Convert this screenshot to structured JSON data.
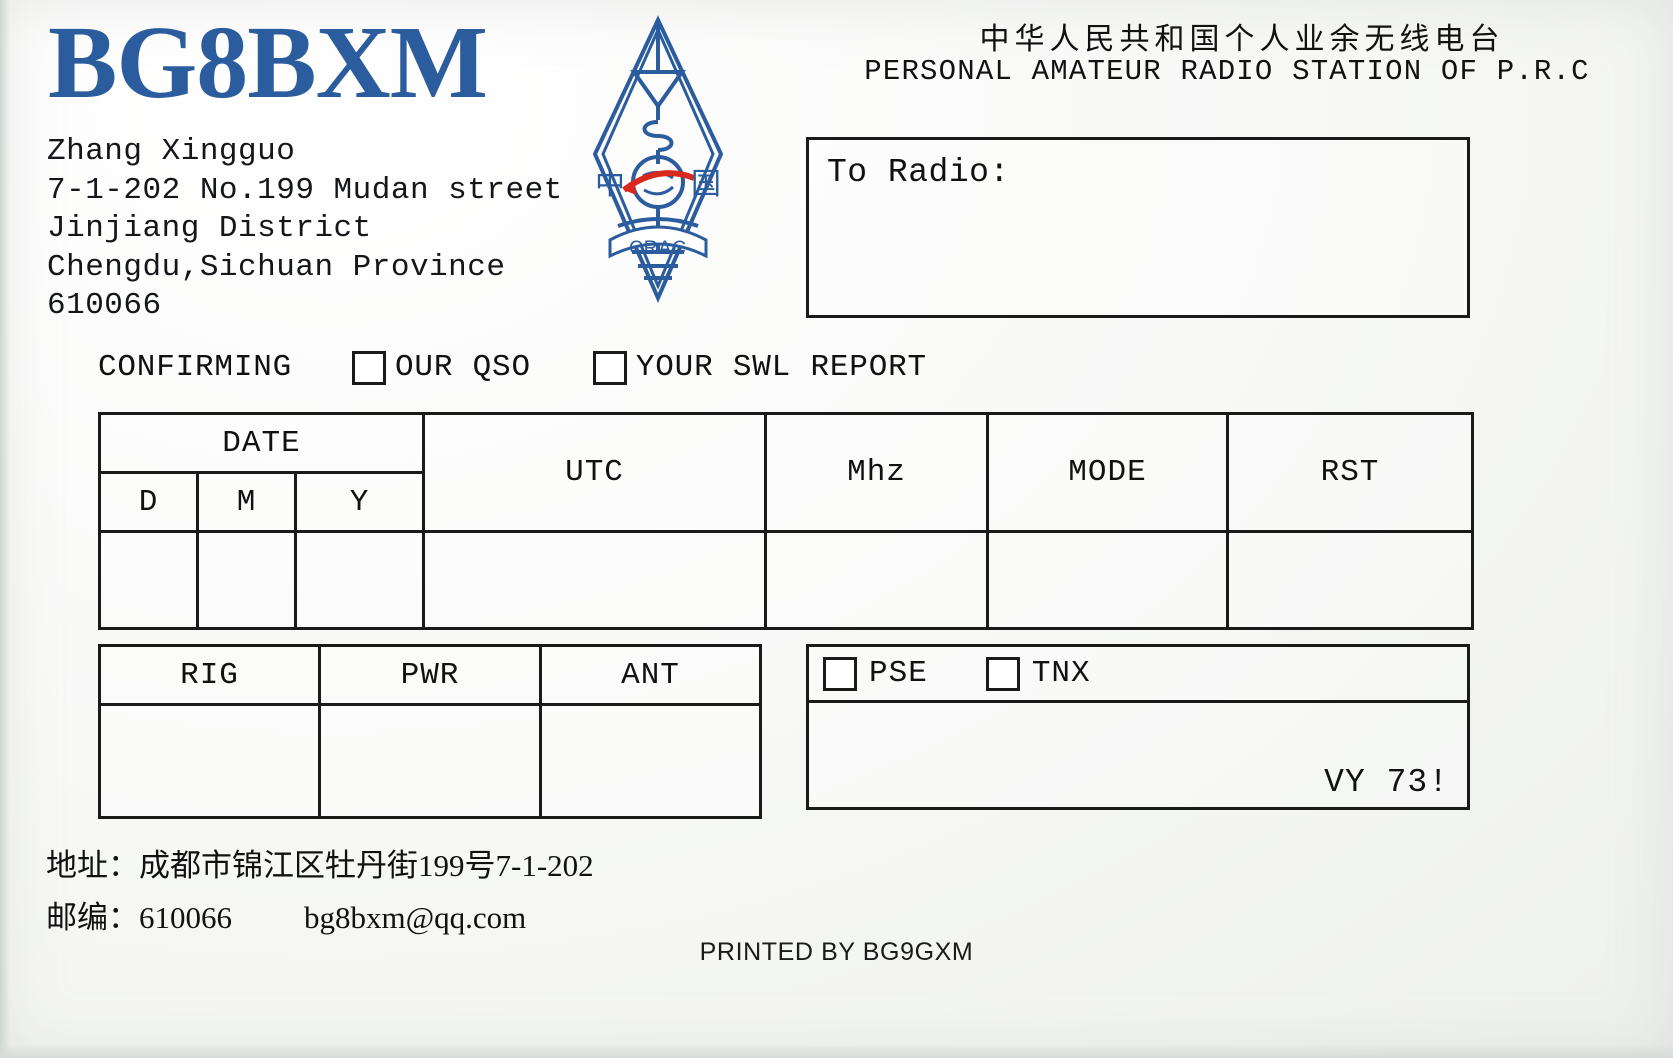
{
  "card": {
    "callsign": "BG8BXM",
    "accent_color": "#2b5c9e",
    "ink_color": "#111111"
  },
  "header": {
    "chinese": "中华人民共和国个人业余无线电台",
    "english": "PERSONAL AMATEUR RADIO STATION OF P.R.C"
  },
  "logo": {
    "name": "crac-logo",
    "org_abbrev": "CRAC",
    "left_char": "中",
    "right_char": "国",
    "color": "#2b5c9e",
    "accent_red": "#d9281e"
  },
  "address_en": [
    "Zhang Xingguo",
    "7-1-202 No.199 Mudan street",
    "Jinjiang District",
    "Chengdu,Sichuan Province",
    "610066"
  ],
  "to_radio": {
    "label": "To Radio:",
    "value": ""
  },
  "confirming": {
    "label": "CONFIRMING",
    "options": [
      {
        "label": "OUR QSO",
        "checked": false
      },
      {
        "label": "YOUR SWL REPORT",
        "checked": false
      }
    ]
  },
  "qso_table": {
    "headers": [
      "DATE",
      "UTC",
      "Mhz",
      "MODE",
      "RST"
    ],
    "date_subheaders": [
      "D",
      "M",
      "Y"
    ],
    "values": {
      "D": "",
      "M": "",
      "Y": "",
      "UTC": "",
      "Mhz": "",
      "MODE": "",
      "RST": ""
    }
  },
  "rig_table": {
    "headers": [
      "RIG",
      "PWR",
      "ANT"
    ],
    "values": {
      "RIG": "",
      "PWR": "",
      "ANT": ""
    }
  },
  "pse_tnx": {
    "options": [
      {
        "label": "PSE",
        "checked": false
      },
      {
        "label": "TNX",
        "checked": false
      }
    ],
    "signoff": "VY 73!",
    "remarks": ""
  },
  "footer_cn": {
    "address_label": "地址：",
    "address_value": "成都市锦江区牡丹街199号7-1-202",
    "zip_label": "邮编：",
    "zip_value": "610066",
    "email": "bg8bxm@qq.com"
  },
  "printed_by": "PRINTED BY BG9GXM"
}
